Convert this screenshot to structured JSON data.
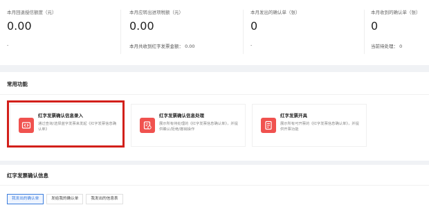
{
  "stats": [
    {
      "label": "本月回退授信额度（元）",
      "value": "0.00",
      "foot": "-"
    },
    {
      "label": "本月应转出进项税额（元）",
      "value": "0.00",
      "foot": "本月共收到红字发票金额： 0.00"
    },
    {
      "label": "本月发出的确认单（张）",
      "value": "0",
      "foot": "-"
    },
    {
      "label": "本月收到的确认单（张）",
      "value": "0",
      "foot": "当前待处理： 0"
    }
  ],
  "common": {
    "title": "常用功能",
    "cards": [
      {
        "title": "红字发票确认信息录入",
        "desc": "通过查询/选择蓝字发票来发起《红字发票信息确认单》",
        "icon": "invoice-entry-icon"
      },
      {
        "title": "红字发票确认信息处理",
        "desc": "展示所有待处理的《红字发票信息确认单》，并提供确认/拒绝/撤销操作",
        "icon": "invoice-process-icon"
      },
      {
        "title": "红字发票开具",
        "desc": "展示所有可开票的《红字发票信息确认单》，并提供开票功能",
        "icon": "invoice-issue-icon"
      }
    ]
  },
  "info": {
    "title": "红字发票确认信息",
    "tabs": [
      {
        "label": "我发出的确认单",
        "active": true
      },
      {
        "label": "发给我的确认单",
        "active": false
      },
      {
        "label": "我发出的信息表",
        "active": false
      }
    ]
  },
  "colors": {
    "accent": "#3b7ddd",
    "icon_red": "#f0524f",
    "highlight": "#d21f1a"
  }
}
